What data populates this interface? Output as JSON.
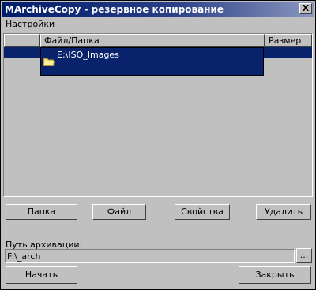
{
  "window": {
    "title": "MArchiveCopy - резервное копирование",
    "close_label": "X"
  },
  "menu": {
    "items": [
      "Настройки"
    ]
  },
  "list": {
    "columns": [
      "",
      "Файл/Папка",
      "Размер"
    ],
    "rows": [
      {
        "icon": "folder-icon",
        "name": "E:\\ISO_Images",
        "size": "",
        "selected": true
      }
    ]
  },
  "buttons": {
    "folder": "Папка",
    "file": "Файл",
    "properties": "Свойства",
    "delete": "Удалить"
  },
  "path": {
    "label": "Путь архивации:",
    "value": "F:\\_arch",
    "browse": "..."
  },
  "actions": {
    "start": "Начать",
    "close": "Закрыть"
  },
  "colors": {
    "titlebar": "#001c6b",
    "selection": "#08226b",
    "face": "#c0c0c0"
  }
}
